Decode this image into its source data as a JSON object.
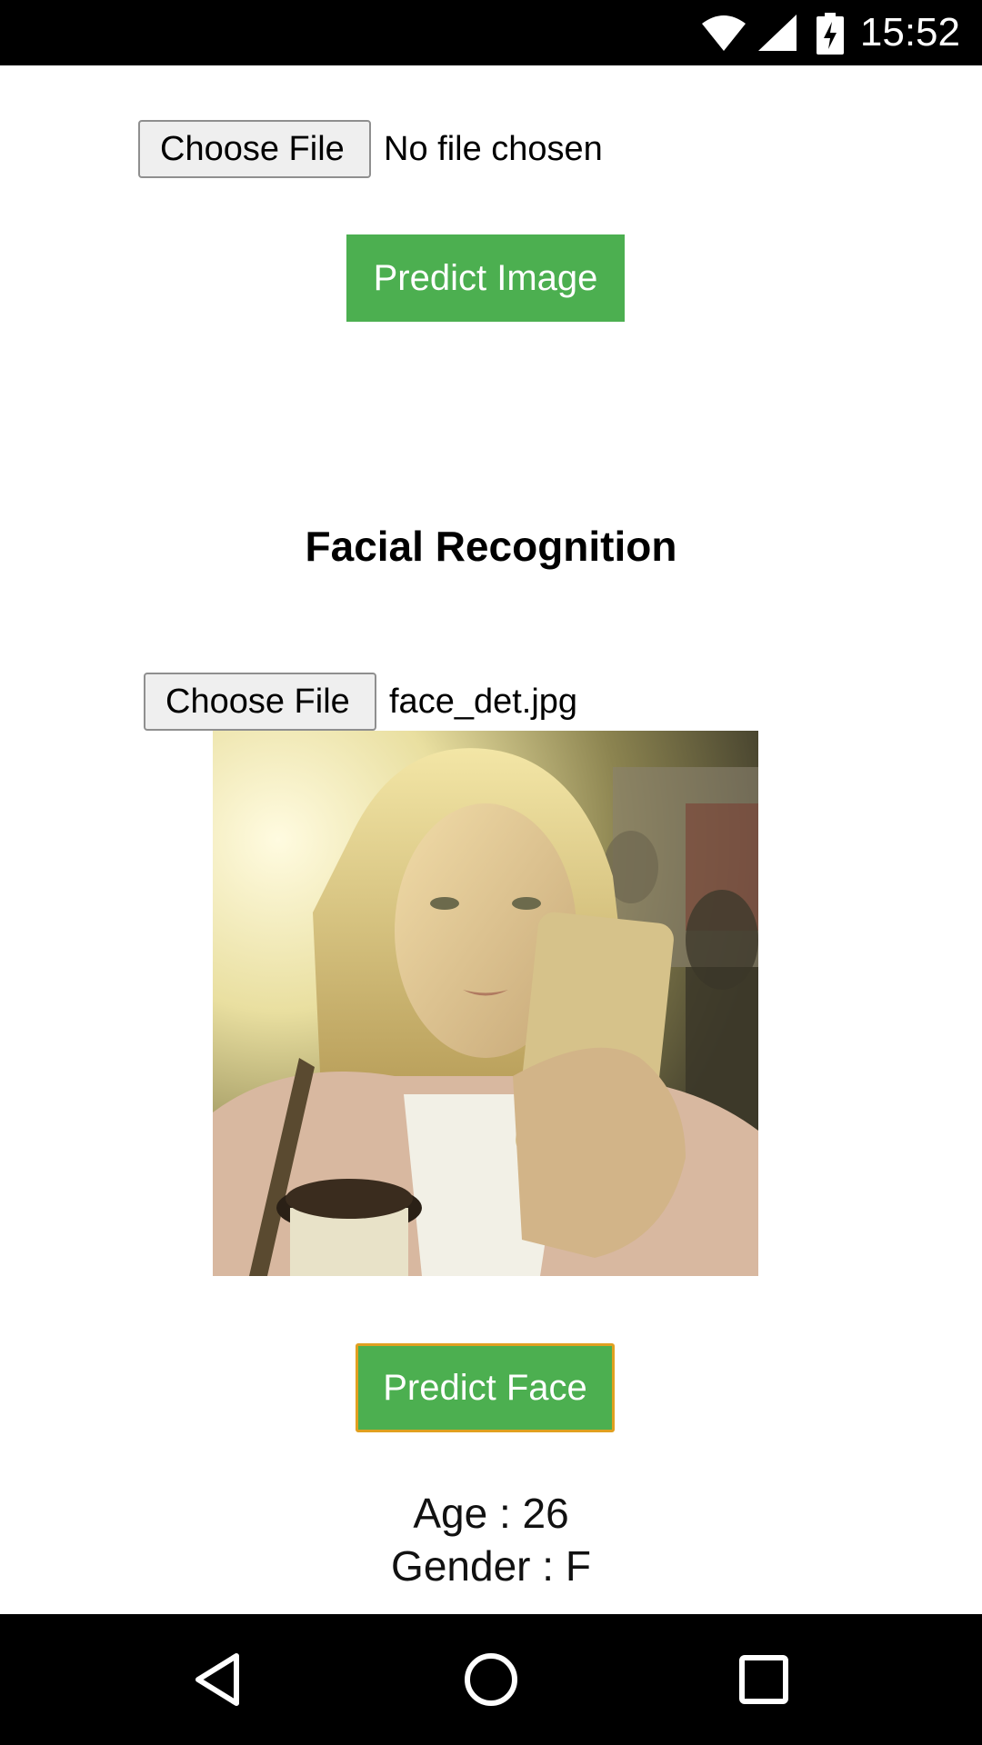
{
  "status_bar": {
    "time": "15:52",
    "icons": [
      "wifi-icon",
      "signal-icon",
      "battery-charging-icon"
    ]
  },
  "upload_image": {
    "choose_label": "Choose File",
    "file_status": "No file chosen",
    "predict_label": "Predict Image"
  },
  "face_section": {
    "title": "Facial Recognition",
    "choose_label": "Choose File",
    "file_name": "face_det.jpg",
    "predict_label": "Predict Face"
  },
  "result": {
    "age_label": "Age",
    "age_value": "26",
    "gender_label": "Gender",
    "gender_value": "F"
  },
  "nav_bar": {
    "icons": [
      "back-icon",
      "home-icon",
      "recents-icon"
    ]
  },
  "colors": {
    "accent_green": "#4caf50",
    "focus_outline": "#e0a020"
  }
}
